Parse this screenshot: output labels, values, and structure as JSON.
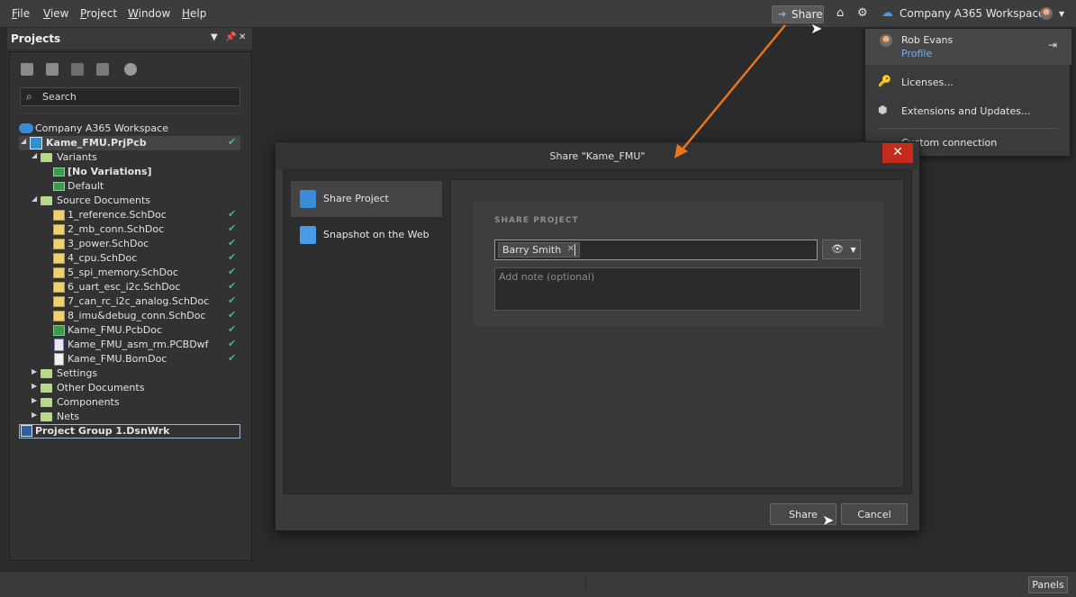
{
  "menubar": {
    "items": [
      "File",
      "View",
      "Project",
      "Window",
      "Help"
    ],
    "share_label": "Share",
    "workspace_label": "Company A365 Workspace"
  },
  "projects_panel": {
    "title": "Projects",
    "search_placeholder": "Search",
    "tree": {
      "workspace": "Company A365 Workspace",
      "project": "Kame_FMU.PrjPcb",
      "variants_folder": "Variants",
      "variants": [
        "[No Variations]",
        "Default"
      ],
      "source_folder": "Source Documents",
      "documents": [
        "1_reference.SchDoc",
        "2_mb_conn.SchDoc",
        "3_power.SchDoc",
        "4_cpu.SchDoc",
        "5_spi_memory.SchDoc",
        "6_uart_esc_i2c.SchDoc",
        "7_can_rc_i2c_analog.SchDoc",
        "8_imu&debug_conn.SchDoc",
        "Kame_FMU.PcbDoc",
        "Kame_FMU_asm_rm.PCBDwf",
        "Kame_FMU.BomDoc"
      ],
      "other_folders": [
        "Settings",
        "Other Documents",
        "Components",
        "Nets"
      ],
      "project_group": "Project Group 1.DsnWrk"
    }
  },
  "user_menu": {
    "name": "Rob Evans",
    "profile_link": "Profile",
    "items": [
      "Licenses...",
      "Extensions and Updates...",
      "Custom connection"
    ]
  },
  "dialog": {
    "title": "Share \"Kame_FMU\"",
    "nav": [
      "Share Project",
      "Snapshot on the Web"
    ],
    "heading": "SHARE PROJECT",
    "recipient_chip": "Barry Smith",
    "note_placeholder": "Add note (optional)",
    "share_button": "Share",
    "cancel_button": "Cancel"
  },
  "statusbar": {
    "panels_button": "Panels"
  },
  "colors": {
    "accent_link": "#6db0ff",
    "close_red": "#c42b1c",
    "annotation_orange": "#e8741e",
    "check_green": "#35c46a"
  }
}
